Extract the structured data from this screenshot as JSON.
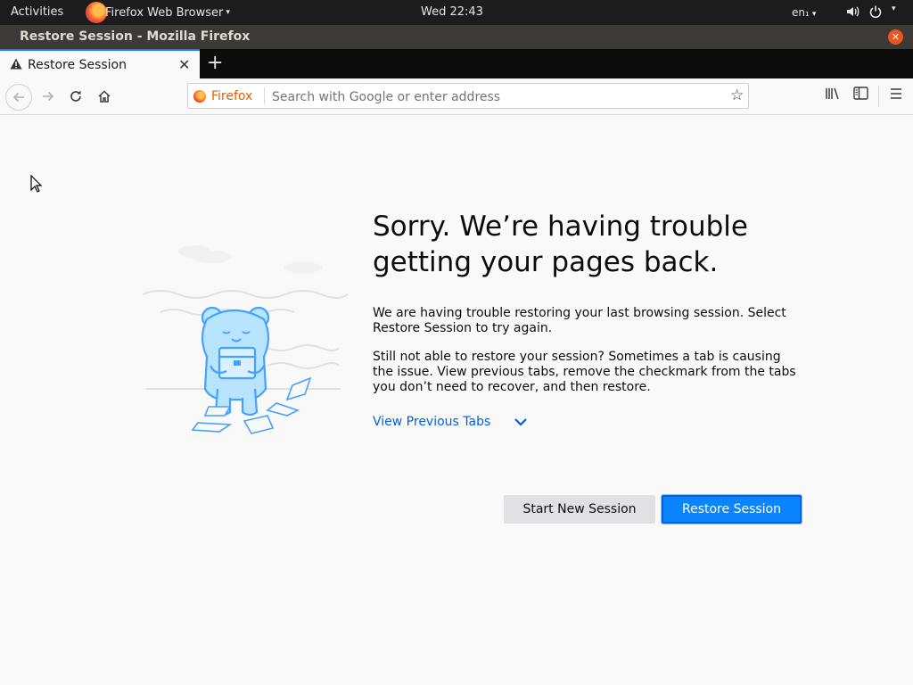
{
  "system_bar": {
    "activities": "Activities",
    "app_name": "Firefox Web Browser",
    "app_arrow": "▾",
    "clock": "Wed 22:43",
    "lang": "en₁",
    "lang_arrow": "▾"
  },
  "window": {
    "title": "Restore Session - Mozilla Firefox"
  },
  "tab": {
    "label": "Restore Session",
    "icon": "warning-icon"
  },
  "toolbar": {
    "url_badge": "Firefox",
    "url_placeholder": "Search with Google or enter address"
  },
  "content": {
    "heading": "Sorry. We’re having trouble getting your pages back.",
    "paragraph1": "We are having trouble restoring your last browsing session. Select Restore Session to try again.",
    "paragraph2": "Still not able to restore your session? Sometimes a tab is causing the issue. View previous tabs, remove the checkmark from the tabs you don’t need to recover, and then restore.",
    "view_previous_tabs": "View Previous Tabs",
    "start_new_session": "Start New Session",
    "restore_session": "Restore Session"
  },
  "colors": {
    "accent": "#0a84ff",
    "accent_dark": "#0060df",
    "illustration_stroke": "#45a1ff",
    "illustration_fill": "#b9e4ff"
  }
}
